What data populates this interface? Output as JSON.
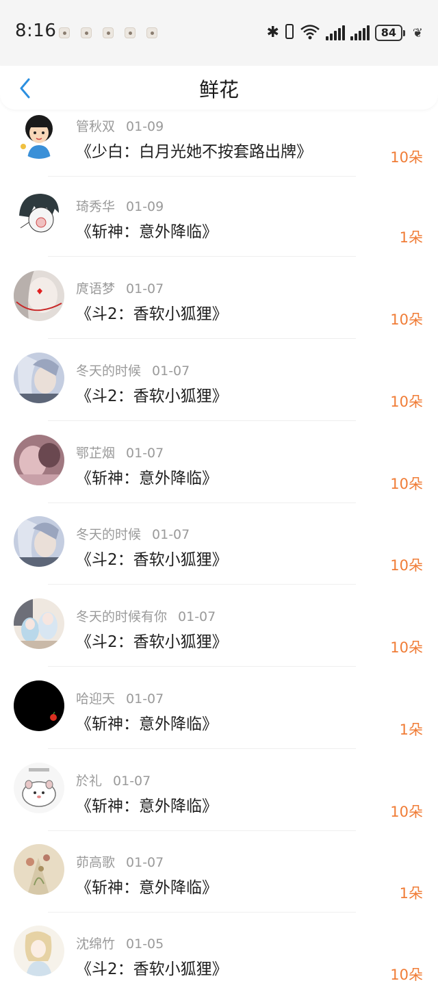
{
  "status_bar": {
    "time": "8:16",
    "battery": "84",
    "notification_icons": [
      "app-notification-1",
      "app-notification-2",
      "app-notification-3",
      "app-notification-4",
      "app-notification-5"
    ]
  },
  "header": {
    "title": "鲜花",
    "back_icon": "chevron-left-icon"
  },
  "colors": {
    "accent": "#f07c36",
    "back": "#2b8fe0",
    "name": "#9a9a9a"
  },
  "rows": [
    {
      "name": "管秋双",
      "date": "01-09",
      "book": "《少白：白月光她不按套路出牌》",
      "qty": "10朵"
    },
    {
      "name": "琦秀华",
      "date": "01-09",
      "book": "《斩神：意外降临》",
      "qty": "1朵"
    },
    {
      "name": "庹语梦",
      "date": "01-07",
      "book": "《斗2：香软小狐狸》",
      "qty": "10朵"
    },
    {
      "name": "冬天的时候",
      "date": "01-07",
      "book": "《斗2：香软小狐狸》",
      "qty": "10朵"
    },
    {
      "name": "鄂芷烟",
      "date": "01-07",
      "book": "《斩神：意外降临》",
      "qty": "10朵"
    },
    {
      "name": "冬天的时候",
      "date": "01-07",
      "book": "《斗2：香软小狐狸》",
      "qty": "10朵"
    },
    {
      "name": "冬天的时候有你",
      "date": "01-07",
      "book": "《斗2：香软小狐狸》",
      "qty": "10朵"
    },
    {
      "name": "哈迎天",
      "date": "01-07",
      "book": "《斩神：意外降临》",
      "qty": "1朵"
    },
    {
      "name": "於礼",
      "date": "01-07",
      "book": "《斩神：意外降临》",
      "qty": "10朵"
    },
    {
      "name": "茆高歌",
      "date": "01-07",
      "book": "《斩神：意外降临》",
      "qty": "1朵"
    },
    {
      "name": "沈绵竹",
      "date": "01-05",
      "book": "《斗2：香软小狐狸》",
      "qty": "10朵"
    }
  ]
}
